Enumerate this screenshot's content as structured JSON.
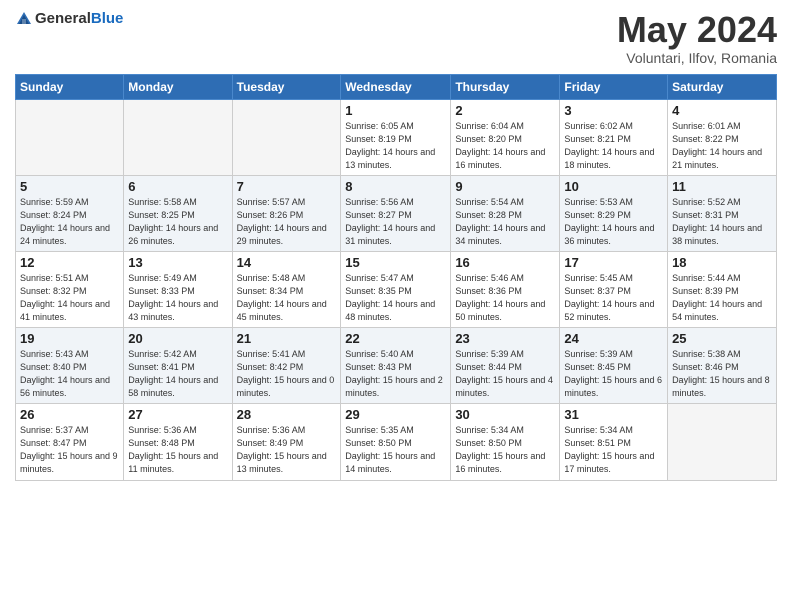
{
  "header": {
    "logo_general": "General",
    "logo_blue": "Blue",
    "month_title": "May 2024",
    "subtitle": "Voluntari, Ilfov, Romania"
  },
  "weekdays": [
    "Sunday",
    "Monday",
    "Tuesday",
    "Wednesday",
    "Thursday",
    "Friday",
    "Saturday"
  ],
  "weeks": [
    [
      {
        "day": "",
        "sunrise": "",
        "sunset": "",
        "daylight": "",
        "empty": true
      },
      {
        "day": "",
        "sunrise": "",
        "sunset": "",
        "daylight": "",
        "empty": true
      },
      {
        "day": "",
        "sunrise": "",
        "sunset": "",
        "daylight": "",
        "empty": true
      },
      {
        "day": "1",
        "sunrise": "Sunrise: 6:05 AM",
        "sunset": "Sunset: 8:19 PM",
        "daylight": "Daylight: 14 hours and 13 minutes."
      },
      {
        "day": "2",
        "sunrise": "Sunrise: 6:04 AM",
        "sunset": "Sunset: 8:20 PM",
        "daylight": "Daylight: 14 hours and 16 minutes."
      },
      {
        "day": "3",
        "sunrise": "Sunrise: 6:02 AM",
        "sunset": "Sunset: 8:21 PM",
        "daylight": "Daylight: 14 hours and 18 minutes."
      },
      {
        "day": "4",
        "sunrise": "Sunrise: 6:01 AM",
        "sunset": "Sunset: 8:22 PM",
        "daylight": "Daylight: 14 hours and 21 minutes."
      }
    ],
    [
      {
        "day": "5",
        "sunrise": "Sunrise: 5:59 AM",
        "sunset": "Sunset: 8:24 PM",
        "daylight": "Daylight: 14 hours and 24 minutes."
      },
      {
        "day": "6",
        "sunrise": "Sunrise: 5:58 AM",
        "sunset": "Sunset: 8:25 PM",
        "daylight": "Daylight: 14 hours and 26 minutes."
      },
      {
        "day": "7",
        "sunrise": "Sunrise: 5:57 AM",
        "sunset": "Sunset: 8:26 PM",
        "daylight": "Daylight: 14 hours and 29 minutes."
      },
      {
        "day": "8",
        "sunrise": "Sunrise: 5:56 AM",
        "sunset": "Sunset: 8:27 PM",
        "daylight": "Daylight: 14 hours and 31 minutes."
      },
      {
        "day": "9",
        "sunrise": "Sunrise: 5:54 AM",
        "sunset": "Sunset: 8:28 PM",
        "daylight": "Daylight: 14 hours and 34 minutes."
      },
      {
        "day": "10",
        "sunrise": "Sunrise: 5:53 AM",
        "sunset": "Sunset: 8:29 PM",
        "daylight": "Daylight: 14 hours and 36 minutes."
      },
      {
        "day": "11",
        "sunrise": "Sunrise: 5:52 AM",
        "sunset": "Sunset: 8:31 PM",
        "daylight": "Daylight: 14 hours and 38 minutes."
      }
    ],
    [
      {
        "day": "12",
        "sunrise": "Sunrise: 5:51 AM",
        "sunset": "Sunset: 8:32 PM",
        "daylight": "Daylight: 14 hours and 41 minutes."
      },
      {
        "day": "13",
        "sunrise": "Sunrise: 5:49 AM",
        "sunset": "Sunset: 8:33 PM",
        "daylight": "Daylight: 14 hours and 43 minutes."
      },
      {
        "day": "14",
        "sunrise": "Sunrise: 5:48 AM",
        "sunset": "Sunset: 8:34 PM",
        "daylight": "Daylight: 14 hours and 45 minutes."
      },
      {
        "day": "15",
        "sunrise": "Sunrise: 5:47 AM",
        "sunset": "Sunset: 8:35 PM",
        "daylight": "Daylight: 14 hours and 48 minutes."
      },
      {
        "day": "16",
        "sunrise": "Sunrise: 5:46 AM",
        "sunset": "Sunset: 8:36 PM",
        "daylight": "Daylight: 14 hours and 50 minutes."
      },
      {
        "day": "17",
        "sunrise": "Sunrise: 5:45 AM",
        "sunset": "Sunset: 8:37 PM",
        "daylight": "Daylight: 14 hours and 52 minutes."
      },
      {
        "day": "18",
        "sunrise": "Sunrise: 5:44 AM",
        "sunset": "Sunset: 8:39 PM",
        "daylight": "Daylight: 14 hours and 54 minutes."
      }
    ],
    [
      {
        "day": "19",
        "sunrise": "Sunrise: 5:43 AM",
        "sunset": "Sunset: 8:40 PM",
        "daylight": "Daylight: 14 hours and 56 minutes."
      },
      {
        "day": "20",
        "sunrise": "Sunrise: 5:42 AM",
        "sunset": "Sunset: 8:41 PM",
        "daylight": "Daylight: 14 hours and 58 minutes."
      },
      {
        "day": "21",
        "sunrise": "Sunrise: 5:41 AM",
        "sunset": "Sunset: 8:42 PM",
        "daylight": "Daylight: 15 hours and 0 minutes."
      },
      {
        "day": "22",
        "sunrise": "Sunrise: 5:40 AM",
        "sunset": "Sunset: 8:43 PM",
        "daylight": "Daylight: 15 hours and 2 minutes."
      },
      {
        "day": "23",
        "sunrise": "Sunrise: 5:39 AM",
        "sunset": "Sunset: 8:44 PM",
        "daylight": "Daylight: 15 hours and 4 minutes."
      },
      {
        "day": "24",
        "sunrise": "Sunrise: 5:39 AM",
        "sunset": "Sunset: 8:45 PM",
        "daylight": "Daylight: 15 hours and 6 minutes."
      },
      {
        "day": "25",
        "sunrise": "Sunrise: 5:38 AM",
        "sunset": "Sunset: 8:46 PM",
        "daylight": "Daylight: 15 hours and 8 minutes."
      }
    ],
    [
      {
        "day": "26",
        "sunrise": "Sunrise: 5:37 AM",
        "sunset": "Sunset: 8:47 PM",
        "daylight": "Daylight: 15 hours and 9 minutes."
      },
      {
        "day": "27",
        "sunrise": "Sunrise: 5:36 AM",
        "sunset": "Sunset: 8:48 PM",
        "daylight": "Daylight: 15 hours and 11 minutes."
      },
      {
        "day": "28",
        "sunrise": "Sunrise: 5:36 AM",
        "sunset": "Sunset: 8:49 PM",
        "daylight": "Daylight: 15 hours and 13 minutes."
      },
      {
        "day": "29",
        "sunrise": "Sunrise: 5:35 AM",
        "sunset": "Sunset: 8:50 PM",
        "daylight": "Daylight: 15 hours and 14 minutes."
      },
      {
        "day": "30",
        "sunrise": "Sunrise: 5:34 AM",
        "sunset": "Sunset: 8:50 PM",
        "daylight": "Daylight: 15 hours and 16 minutes."
      },
      {
        "day": "31",
        "sunrise": "Sunrise: 5:34 AM",
        "sunset": "Sunset: 8:51 PM",
        "daylight": "Daylight: 15 hours and 17 minutes."
      },
      {
        "day": "",
        "sunrise": "",
        "sunset": "",
        "daylight": "",
        "empty": true
      }
    ]
  ]
}
